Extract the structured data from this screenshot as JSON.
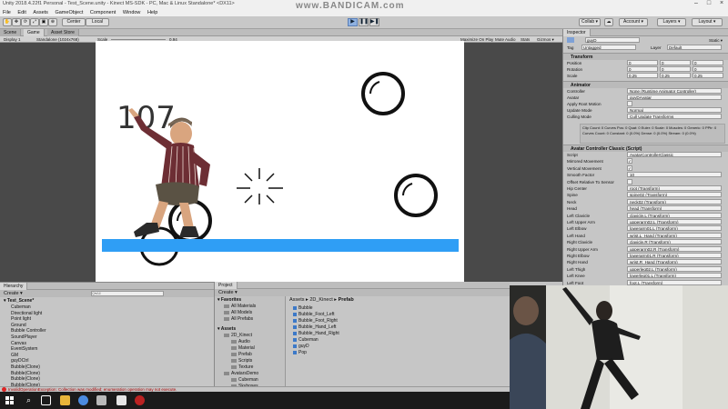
{
  "window": {
    "title": "Unity 2018.4.22f1 Personal - Test_Scene.unity - Kinect MS-SDK - PC, Mac & Linux Standalone* <DX11>",
    "minimize": "–",
    "maximize": "□",
    "close": "×"
  },
  "watermark": "www.BANDICAM.com",
  "menu": [
    "File",
    "Edit",
    "Assets",
    "GameObject",
    "Component",
    "Window",
    "Help"
  ],
  "toolbar": {
    "pivot": "Center",
    "space": "Local",
    "play": "▶",
    "pause": "❚❚",
    "step": "▶❚",
    "collab": "Collab ▾",
    "account": "Account ▾",
    "layers": "Layers ▾",
    "layout": "Layout ▾"
  },
  "scene_tabs": [
    "Scene",
    "Game",
    "Asset Store"
  ],
  "game_bar": {
    "display": "Display 1",
    "resolution": "Standalone (1024x768)",
    "scale_label": "Scale",
    "scale_value": "0.94",
    "options": [
      "Maximize On Play",
      "Mute Audio",
      "Stats",
      "Gizmos ▾"
    ]
  },
  "game": {
    "score": "107"
  },
  "inspector": {
    "tab": "Inspector",
    "name": "guyD",
    "static": "Static ▾",
    "tag_label": "Tag",
    "tag": "Untagged",
    "layer_label": "Layer",
    "layer": "Default",
    "transform": {
      "title": "Transform",
      "position_label": "Position",
      "rotation_label": "Rotation",
      "scale_label": "Scale",
      "position": [
        "0",
        "0",
        "0"
      ],
      "rotation": [
        "0",
        "0",
        "0"
      ],
      "scale": [
        "0.25",
        "0.25",
        "0.25"
      ]
    },
    "animator": {
      "title": "Animator",
      "rows": [
        {
          "label": "Controller",
          "value": "None (Runtime Animator Controller)"
        },
        {
          "label": "Avatar",
          "value": "guyDAvatar"
        },
        {
          "label": "Apply Root Motion",
          "value": ""
        },
        {
          "label": "Update Mode",
          "value": "Normal"
        },
        {
          "label": "Culling Mode",
          "value": "Cull Update Transforms"
        }
      ],
      "info": "Clip Count: 0  Curves Pos: 0 Quat: 0 Euler: 0 Scale: 0 Muscles: 0 Generic: 0 PPtr: 0  Curves Count: 0 Constant: 0 (0.0%) Dense: 0 (0.0%) Stream: 0 (0.0%)"
    },
    "avatar_controller": {
      "title": "Avatar Controller Classic (Script)",
      "script": "AvatarControllerClassic",
      "rows": [
        {
          "label": "Script",
          "value": "AvatarControllerClassic"
        },
        {
          "label": "Mirrored Movement",
          "value": "✓"
        },
        {
          "label": "Vertical Movement",
          "value": "✓"
        },
        {
          "label": "Smooth Factor",
          "value": "10"
        },
        {
          "label": "Offset Relative To Sensor",
          "value": ""
        },
        {
          "label": "Hip Center",
          "value": "root (Transform)"
        },
        {
          "label": "Spine",
          "value": "spine02 (Transform)"
        },
        {
          "label": "Neck",
          "value": "neck02 (Transform)"
        },
        {
          "label": "Head",
          "value": "head (Transform)"
        },
        {
          "label": "Left Clavicle",
          "value": "clavicle.L (Transform)"
        },
        {
          "label": "Left Upper Arm",
          "value": "upperarm02.L (Transform)"
        },
        {
          "label": "Left Elbow",
          "value": "lowerarm01.L (Transform)"
        },
        {
          "label": "Left Hand",
          "value": "wrist.L_Hand (Transform)"
        },
        {
          "label": "Right Clavicle",
          "value": "clavicle.R (Transform)"
        },
        {
          "label": "Right Upper Arm",
          "value": "upperarm02.R (Transform)"
        },
        {
          "label": "Right Elbow",
          "value": "lowerarm01.R (Transform)"
        },
        {
          "label": "Right Hand",
          "value": "wrist.R_Hand (Transform)"
        },
        {
          "label": "Left Thigh",
          "value": "upperleg02.L (Transform)"
        },
        {
          "label": "Left Knee",
          "value": "lowerleg01.L (Transform)"
        },
        {
          "label": "Left Foot",
          "value": "foot.L (Transform)"
        }
      ]
    }
  },
  "hierarchy": {
    "tab": "Hierarchy",
    "create": "Create ▾",
    "search_placeholder": "Q▾All",
    "scene": "Test_Scene*",
    "items": [
      "Cubeman",
      "Directional light",
      "Point light",
      "Ground",
      "Bubble Controller",
      "SoundPlayer",
      "Canvas",
      "EventSystem",
      "GM",
      "guyDCtrl",
      "Bubble(Clone)",
      "Bubble(Clone)",
      "Bubble(Clone)",
      "Bubble(Clone)"
    ]
  },
  "project": {
    "tab": "Project",
    "create": "Create ▾",
    "breadcrumb": [
      "Assets",
      "2D_Kinect",
      "Prefab"
    ],
    "favorites_title": "Favorites",
    "favorites": [
      "All Materials",
      "All Models",
      "All Prefabs"
    ],
    "assets_title": "Assets",
    "tree": [
      "2D_Kinect",
      "Audio",
      "Material",
      "Prefab",
      "Scripts",
      "Texture",
      "AvatarsDemo",
      "Cubeman",
      "Skyboxes"
    ],
    "files": [
      "Bubble",
      "Bubble_Foot_Left",
      "Bubble_Foot_Right",
      "Bubble_Hand_Left",
      "Bubble_Hand_Right",
      "Cubeman",
      "guyD",
      "Pop"
    ]
  },
  "status": "InvalidOperationException: Collection was modified; enumeration operation may not execute."
}
